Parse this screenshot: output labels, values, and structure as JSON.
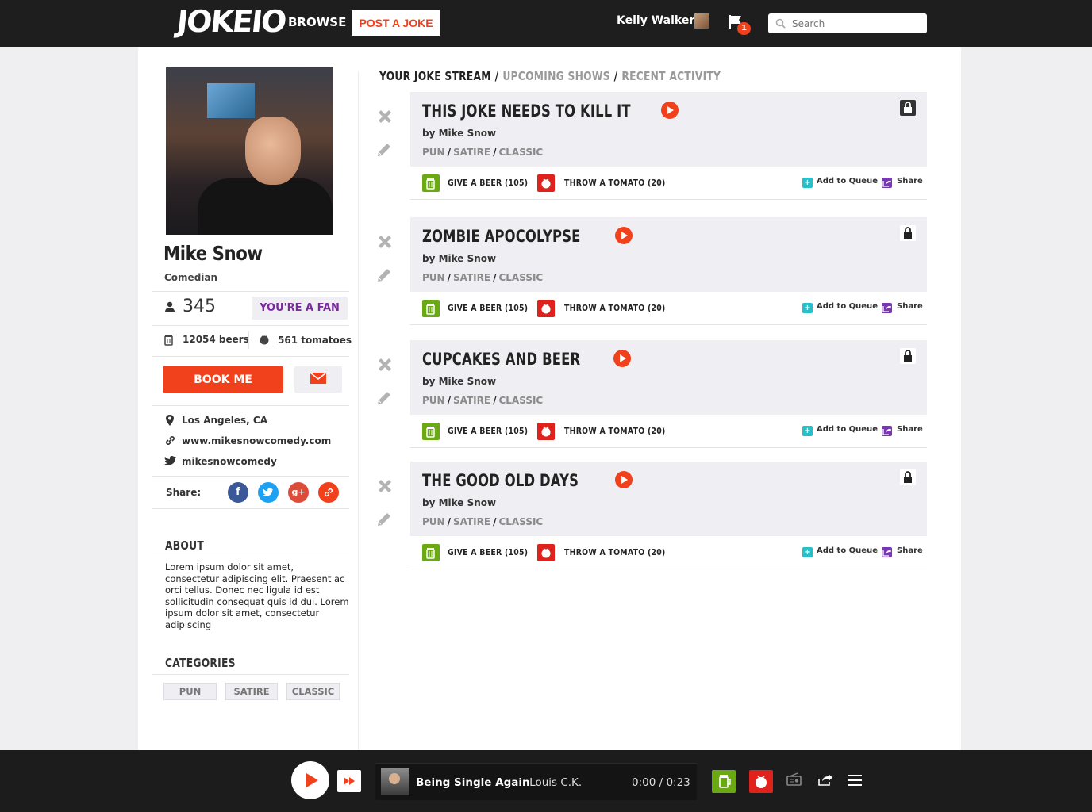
{
  "topbar": {
    "logo_text": "JOKEIO",
    "browse_label": "BROWSE",
    "post_label": "POST A JOKE",
    "user_name": "Kelly Walker",
    "notification_count": "1",
    "search_placeholder": "Search"
  },
  "profile": {
    "name": "Mike Snow",
    "role": "Comedian",
    "fans": "345",
    "fan_button": "YOU'RE A FAN",
    "beers": "12054 beers",
    "tomatoes": "561 tomatoes",
    "book_label": "BOOK ME",
    "location": "Los Angeles, CA",
    "website": "www.mikesnowcomedy.com",
    "twitter": "mikesnowcomedy",
    "share_label": "Share:",
    "about_title": "ABOUT",
    "about_text": "Lorem ipsum dolor sit amet, consectetur adipiscing elit. Praesent ac orci tellus. Donec nec ligula id est sollicitudin consequat quis id dui. Lorem ipsum dolor sit amet, consectetur adipiscing",
    "categories_title": "CATEGORIES",
    "categories": [
      "PUN",
      "SATIRE",
      "CLASSIC"
    ]
  },
  "stream": {
    "tabs": [
      "YOUR JOKE STREAM",
      "UPCOMING SHOWS",
      "RECENT ACTIVITY"
    ],
    "jokes": [
      {
        "title": "THIS JOKE NEEDS TO KILL IT",
        "author": "by Mike Snow",
        "tags": [
          "PUN",
          "SATIRE",
          "CLASSIC"
        ]
      },
      {
        "title": "ZOMBIE APOCOLYPSE",
        "author": "by Mike Snow",
        "tags": [
          "PUN",
          "SATIRE",
          "CLASSIC"
        ]
      },
      {
        "title": "CUPCAKES AND BEER",
        "author": "by Mike Snow",
        "tags": [
          "PUN",
          "SATIRE",
          "CLASSIC"
        ]
      },
      {
        "title": "THE GOOD OLD DAYS",
        "author": "by Mike Snow",
        "tags": [
          "PUN",
          "SATIRE",
          "CLASSIC"
        ]
      }
    ],
    "beer_label": "GIVE A BEER (105)",
    "tomato_label": "THROW A TOMATO (20)",
    "queue_label": "Add to Queue",
    "share_label": "Share"
  },
  "player": {
    "track_title": "Being Single Again",
    "artist": "- Louis C.K.",
    "time": "0:00 / 0:23"
  },
  "colors": {
    "accent": "#f0401c",
    "beer": "#6aa814",
    "tomato": "#e0221c",
    "queue": "#28c0c8",
    "share": "#7a38b0",
    "fan": "#7a2b9e"
  }
}
